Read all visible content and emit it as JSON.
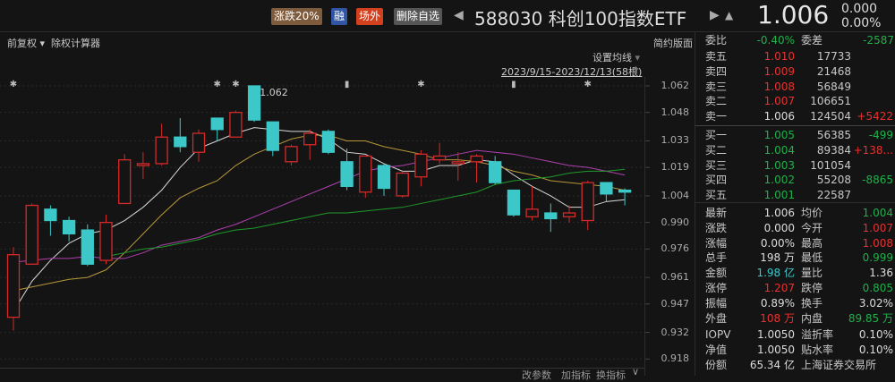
{
  "header": {
    "tags": [
      "涨跌20%",
      "融",
      "场外",
      "删除自选"
    ],
    "code_name": "588030 科创100指数ETF",
    "price": "1.006",
    "change": "0.000",
    "change_pct": "0.00%",
    "prev_icon": "triangle-left-icon",
    "next_icon": "triangle-right-icon",
    "bell_icon": "bell-icon"
  },
  "toolbar": {
    "fuquan": "前复权",
    "calc": "除权计算器",
    "simple": "简约版面",
    "set_ma": "设置均线",
    "date_range": "2023/9/15-2023/12/13(58根)",
    "high_label": "1.062",
    "bottom": [
      "改参数",
      "加指标",
      "换指标"
    ]
  },
  "orderbook": {
    "weibi_label": "委比",
    "weibi": "-0.40%",
    "weicha_label": "委差",
    "weicha": "-2587",
    "sell": [
      {
        "label": "卖五",
        "price": "1.010",
        "vol": "17733",
        "chg": ""
      },
      {
        "label": "卖四",
        "price": "1.009",
        "vol": "21468",
        "chg": ""
      },
      {
        "label": "卖三",
        "price": "1.008",
        "vol": "56849",
        "chg": ""
      },
      {
        "label": "卖二",
        "price": "1.007",
        "vol": "106651",
        "chg": ""
      },
      {
        "label": "卖一",
        "price": "1.006",
        "vol": "124504",
        "chg": "+5422"
      }
    ],
    "buy": [
      {
        "label": "买一",
        "price": "1.005",
        "vol": "56385",
        "chg": "-499"
      },
      {
        "label": "买二",
        "price": "1.004",
        "vol": "89384",
        "chg": "+138..."
      },
      {
        "label": "买三",
        "price": "1.003",
        "vol": "101054",
        "chg": ""
      },
      {
        "label": "买四",
        "price": "1.002",
        "vol": "55208",
        "chg": "-8865"
      },
      {
        "label": "买五",
        "price": "1.001",
        "vol": "22587",
        "chg": ""
      }
    ]
  },
  "stats": [
    {
      "l1": "最新",
      "v1": "1.006",
      "c1": "white",
      "l2": "均价",
      "v2": "1.004",
      "c2": "green"
    },
    {
      "l1": "涨跌",
      "v1": "0.000",
      "c1": "white",
      "l2": "今开",
      "v2": "1.007",
      "c2": "red"
    },
    {
      "l1": "涨幅",
      "v1": "0.00%",
      "c1": "white",
      "l2": "最高",
      "v2": "1.008",
      "c2": "red"
    },
    {
      "l1": "总手",
      "v1": "198 万",
      "c1": "white",
      "l2": "最低",
      "v2": "0.999",
      "c2": "green"
    },
    {
      "l1": "金额",
      "v1": "1.98 亿",
      "c1": "cyan",
      "l2": "量比",
      "v2": "1.36",
      "c2": "white"
    },
    {
      "l1": "涨停",
      "v1": "1.207",
      "c1": "red",
      "l2": "跌停",
      "v2": "0.805",
      "c2": "green"
    },
    {
      "l1": "振幅",
      "v1": "0.89%",
      "c1": "white",
      "l2": "换手",
      "v2": "3.02%",
      "c2": "white"
    },
    {
      "l1": "外盘",
      "v1": "108 万",
      "c1": "red",
      "l2": "内盘",
      "v2": "89.85 万",
      "c2": "green"
    },
    {
      "l1": "IOPV",
      "v1": "1.0050",
      "c1": "white",
      "l2": "溢折率",
      "v2": "0.10%",
      "c2": "white"
    },
    {
      "l1": "净值",
      "v1": "1.0050",
      "c1": "white",
      "l2": "贴水率",
      "v2": "0.10%",
      "c2": "white"
    },
    {
      "l1": "份额",
      "v1": "65.34 亿",
      "c1": "white",
      "l2": "上海证券交易所",
      "v2": "",
      "c2": "white"
    }
  ],
  "chart_data": {
    "type": "candlestick",
    "yticks": [
      "1.062",
      "1.048",
      "1.033",
      "1.019",
      "1.004",
      "0.990",
      "0.976",
      "0.961",
      "0.947",
      "0.932",
      "0.918"
    ],
    "ylim": [
      0.918,
      1.062
    ],
    "ohlc": [
      [
        0.94,
        0.977,
        0.933,
        0.973
      ],
      [
        0.968,
        1.0,
        0.968,
        0.999
      ],
      [
        0.997,
        0.999,
        0.983,
        0.991
      ],
      [
        0.991,
        0.993,
        0.98,
        0.984
      ],
      [
        0.986,
        0.989,
        0.967,
        0.968
      ],
      [
        0.97,
        0.994,
        0.968,
        0.99
      ],
      [
        1.0,
        1.026,
        1.0,
        1.023
      ],
      [
        1.02,
        1.027,
        1.013,
        1.021
      ],
      [
        1.021,
        1.042,
        1.02,
        1.035
      ],
      [
        1.035,
        1.045,
        1.027,
        1.03
      ],
      [
        1.027,
        1.039,
        1.022,
        1.037
      ],
      [
        1.045,
        1.045,
        1.033,
        1.039
      ],
      [
        1.035,
        1.049,
        1.035,
        1.048
      ],
      [
        1.062,
        1.062,
        1.043,
        1.044
      ],
      [
        1.043,
        1.043,
        1.025,
        1.028
      ],
      [
        1.022,
        1.031,
        1.02,
        1.03
      ],
      [
        1.031,
        1.039,
        1.023,
        1.037
      ],
      [
        1.038,
        1.039,
        1.026,
        1.027
      ],
      [
        1.022,
        1.029,
        1.007,
        1.009
      ],
      [
        1.006,
        1.025,
        1.003,
        1.025
      ],
      [
        1.02,
        1.021,
        1.004,
        1.008
      ],
      [
        1.004,
        1.017,
        1.003,
        1.016
      ],
      [
        1.014,
        1.028,
        1.009,
        1.026
      ],
      [
        1.023,
        1.032,
        1.021,
        1.025
      ],
      [
        1.021,
        1.027,
        1.012,
        1.022
      ],
      [
        1.022,
        1.026,
        1.011,
        1.025
      ],
      [
        1.022,
        1.025,
        1.01,
        1.011
      ],
      [
        1.007,
        1.007,
        0.993,
        0.994
      ],
      [
        0.993,
        1.009,
        0.991,
        0.997
      ],
      [
        0.995,
        1.0,
        0.985,
        0.992
      ],
      [
        0.993,
        0.999,
        0.99,
        0.995
      ],
      [
        0.991,
        1.012,
        0.986,
        1.011
      ],
      [
        1.011,
        1.011,
        1.001,
        1.005
      ],
      [
        1.007,
        1.008,
        0.999,
        1.006
      ]
    ],
    "ma": [
      {
        "name": "MA5",
        "color": "#d8d8d8",
        "values": [
          0.943,
          0.959,
          0.97,
          0.979,
          0.984,
          0.986,
          0.991,
          0.998,
          1.007,
          1.019,
          1.029,
          1.033,
          1.037,
          1.04,
          1.039,
          1.038,
          1.038,
          1.034,
          1.027,
          1.026,
          1.021,
          1.017,
          1.017,
          1.02,
          1.02,
          1.023,
          1.022,
          1.015,
          1.009,
          1.004,
          0.998,
          0.998,
          1.001,
          1.002
        ]
      },
      {
        "name": "MA10",
        "color": "#b8973a",
        "values": [
          0.954,
          0.956,
          0.958,
          0.96,
          0.961,
          0.965,
          0.974,
          0.984,
          0.994,
          1.003,
          1.008,
          1.012,
          1.02,
          1.026,
          1.03,
          1.034,
          1.036,
          1.036,
          1.033,
          1.033,
          1.03,
          1.028,
          1.026,
          1.023,
          1.023,
          1.022,
          1.02,
          1.017,
          1.015,
          1.012,
          1.011,
          1.01,
          1.009,
          1.007
        ]
      },
      {
        "name": "MA20",
        "color": "#b040b0",
        "values": [
          0.969,
          0.97,
          0.971,
          0.971,
          0.972,
          0.971,
          0.971,
          0.974,
          0.978,
          0.98,
          0.982,
          0.986,
          0.989,
          0.993,
          0.997,
          1.001,
          1.005,
          1.009,
          1.013,
          1.017,
          1.019,
          1.02,
          1.022,
          1.024,
          1.026,
          1.028,
          1.027,
          1.026,
          1.024,
          1.022,
          1.02,
          1.019,
          1.017,
          1.015
        ]
      },
      {
        "name": "MA30",
        "color": "#1f9a2a",
        "values": [
          null,
          null,
          null,
          null,
          null,
          0.972,
          0.974,
          0.976,
          0.977,
          0.979,
          0.981,
          0.984,
          0.986,
          0.987,
          0.989,
          0.991,
          0.993,
          0.995,
          0.995,
          0.996,
          0.997,
          0.998,
          1.0,
          1.002,
          1.004,
          1.006,
          1.01,
          1.012,
          1.013,
          1.014,
          1.016,
          1.017,
          1.017,
          1.018
        ]
      }
    ],
    "markers": [
      {
        "i": 0,
        "type": "star"
      },
      {
        "i": 11,
        "type": "star"
      },
      {
        "i": 12,
        "type": "star"
      },
      {
        "i": 18,
        "type": "bar"
      },
      {
        "i": 22,
        "type": "star"
      },
      {
        "i": 27,
        "type": "bar"
      },
      {
        "i": 31,
        "type": "star"
      }
    ],
    "colors": {
      "up": "#d42a2a",
      "down": "#3cc8c8"
    }
  }
}
